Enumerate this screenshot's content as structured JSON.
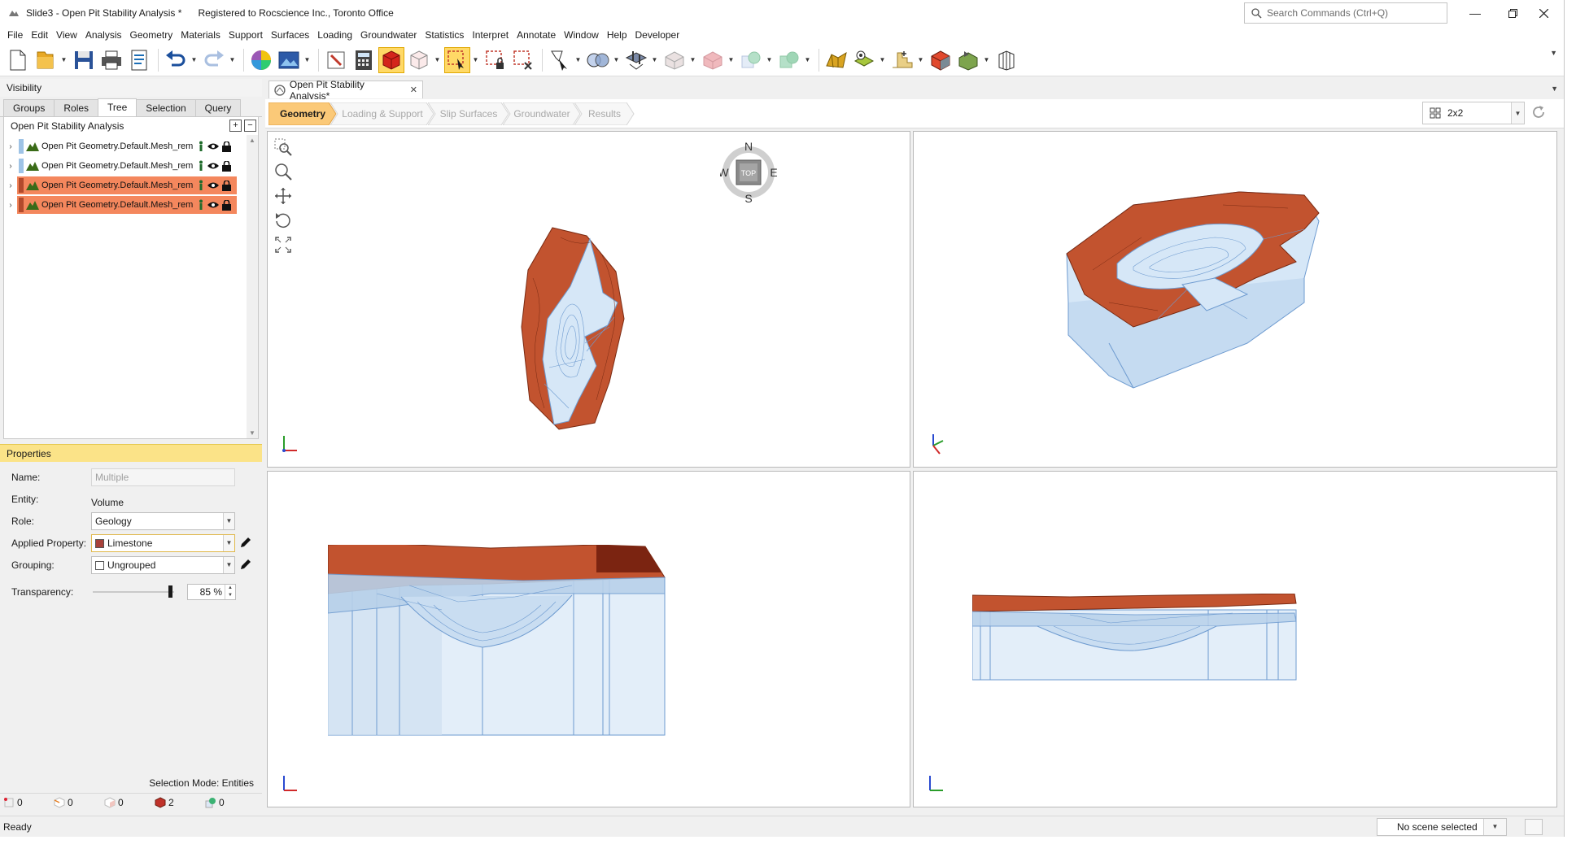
{
  "window": {
    "title": "Slide3 - Open Pit Stability Analysis *",
    "registration": "Registered to Rocscience Inc., Toronto Office",
    "search_placeholder": "Search Commands (Ctrl+Q)"
  },
  "menu": [
    "File",
    "Edit",
    "View",
    "Analysis",
    "Geometry",
    "Materials",
    "Support",
    "Surfaces",
    "Loading",
    "Groundwater",
    "Statistics",
    "Interpret",
    "Annotate",
    "Window",
    "Help",
    "Developer"
  ],
  "toolbar_icons": [
    "new-file-icon",
    "open-folder-icon",
    "save-icon",
    "print-icon",
    "print-preview-icon",
    "undo-icon",
    "redo-icon",
    "color-wheel-icon",
    "image-export-icon",
    "edit-pointer-icon",
    "calculator-icon",
    "solid-view-icon",
    "wireframe-view-icon",
    "select-box-icon",
    "select-locked-icon",
    "deselect-icon",
    "select-pointer-icon",
    "view-shapes-icon",
    "surface-tool-icon",
    "box-tool-icon",
    "cube-tool-icon",
    "intersect-icon",
    "union-icon",
    "mining-icon",
    "mesh-icon",
    "stage-icon",
    "material-cube-icon",
    "export-cube-icon",
    "slice-tool-icon"
  ],
  "visibility": {
    "title": "Visibility",
    "tabs": [
      "Groups",
      "Roles",
      "Tree",
      "Selection",
      "Query"
    ],
    "active_tab": "Tree",
    "tree_title": "Open Pit Stability Analysis",
    "rows": [
      {
        "label": "Open Pit Geometry.Default.Mesh_rem",
        "chip_color": "#9ec3e6",
        "selected": false
      },
      {
        "label": "Open Pit Geometry.Default.Mesh_rem",
        "chip_color": "#9ec3e6",
        "selected": false
      },
      {
        "label": "Open Pit Geometry.Default.Mesh_rem",
        "chip_color": "#b24a2c",
        "selected": true
      },
      {
        "label": "Open Pit Geometry.Default.Mesh_rem",
        "chip_color": "#b24a2c",
        "selected": true
      }
    ]
  },
  "properties": {
    "title": "Properties",
    "name_label": "Name:",
    "name_placeholder": "Multiple",
    "entity_label": "Entity:",
    "entity_value": "Volume",
    "role_label": "Role:",
    "role_value": "Geology",
    "applied_label": "Applied Property:",
    "applied_value": "Limestone",
    "applied_color": "#a8413a",
    "grouping_label": "Grouping:",
    "grouping_value": "Ungrouped",
    "transparency_label": "Transparency:",
    "transparency_value": "85 %",
    "transparency_fraction": 0.85
  },
  "selection_mode": "Selection Mode: Entities",
  "counts": [
    {
      "icon": "vertex-count-icon",
      "value": "0"
    },
    {
      "icon": "edge-count-icon",
      "value": "0"
    },
    {
      "icon": "face-count-icon",
      "value": "0"
    },
    {
      "icon": "volume-count-icon",
      "value": "2"
    },
    {
      "icon": "surface-count-icon",
      "value": "0"
    }
  ],
  "document_tab": "Open Pit Stability Analysis*",
  "workflow": {
    "steps": [
      "Geometry",
      "Loading & Support",
      "Slip Surfaces",
      "Groundwater",
      "Results"
    ],
    "active": "Geometry"
  },
  "layout_option": "2x2",
  "compass": {
    "n": "N",
    "s": "S",
    "e": "E",
    "w": "W",
    "center": "TOP"
  },
  "status": {
    "text": "Ready",
    "scene": "No scene selected"
  },
  "colors": {
    "rock": "#c2532f",
    "rock_dark": "#8a2e18",
    "mesh": "#8fb8e3",
    "volume_fill": "#d6e7f7",
    "highlight": "#f4875d",
    "workflow_active": "#fbc978"
  }
}
